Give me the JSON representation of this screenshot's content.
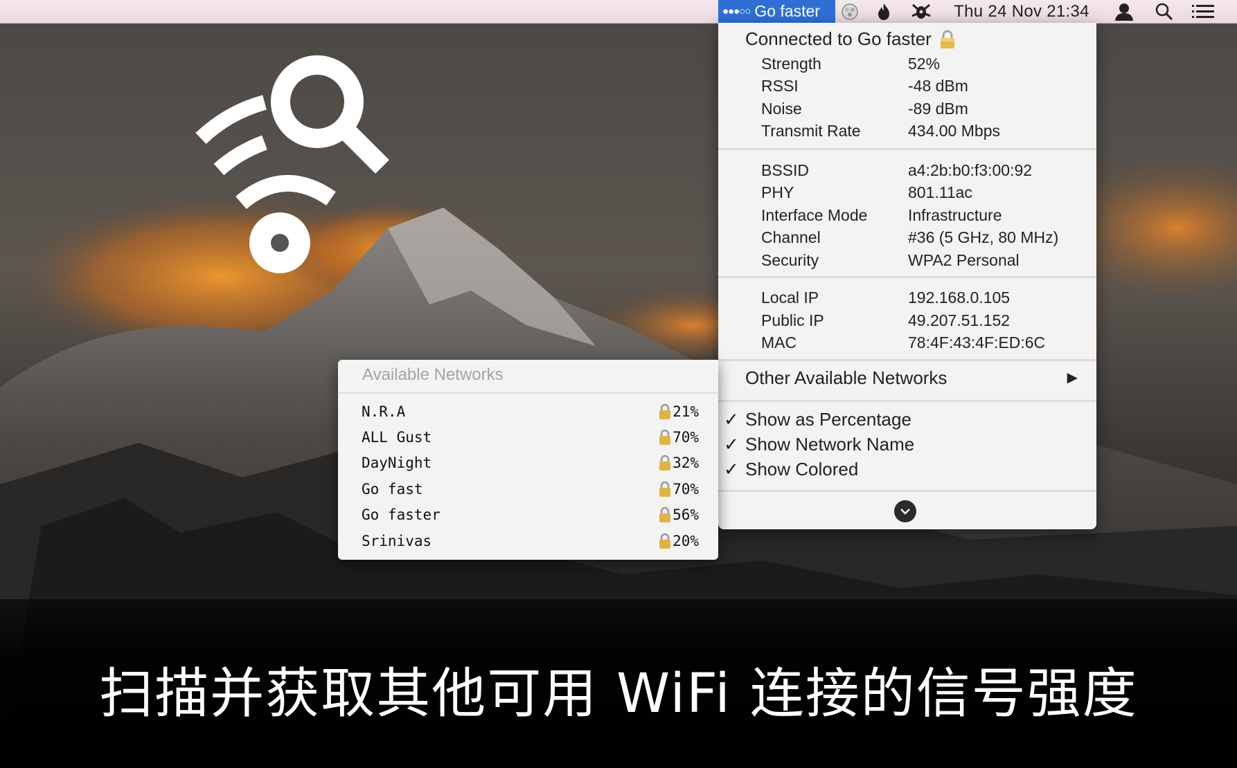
{
  "menubar": {
    "wifi_name": "Go faster",
    "clock": "Thu 24 Nov  21:34",
    "icons": [
      "wifi-signal-dots-icon",
      "colorful-ball-icon",
      "flame-icon",
      "bug-icon",
      "user-icon",
      "search-icon",
      "list-icon"
    ]
  },
  "main_menu": {
    "connected_label": "Connected to Go faster",
    "info_groups": [
      [
        {
          "key": "Strength",
          "value": "52%"
        },
        {
          "key": "RSSI",
          "value": "-48 dBm"
        },
        {
          "key": "Noise",
          "value": "-89 dBm"
        },
        {
          "key": "Transmit Rate",
          "value": "434.00 Mbps"
        }
      ],
      [
        {
          "key": "BSSID",
          "value": "a4:2b:b0:f3:00:92"
        },
        {
          "key": "PHY",
          "value": "801.11ac"
        },
        {
          "key": "Interface Mode",
          "value": "Infrastructure"
        },
        {
          "key": "Channel",
          "value": "#36 (5 GHz, 80 MHz)"
        },
        {
          "key": "Security",
          "value": "WPA2 Personal"
        }
      ],
      [
        {
          "key": "Local IP",
          "value": "192.168.0.105"
        },
        {
          "key": "Public IP",
          "value": "49.207.51.152"
        },
        {
          "key": "MAC",
          "value": "78:4F:43:4F:ED:6C"
        }
      ]
    ],
    "other_networks_label": "Other Available Networks",
    "options": [
      {
        "label": "Show as Percentage",
        "checked": true
      },
      {
        "label": "Show Network Name",
        "checked": true
      },
      {
        "label": "Show Colored",
        "checked": true
      }
    ]
  },
  "submenu": {
    "title": "Available Networks",
    "networks": [
      {
        "name": "N.R.A",
        "strength": "21%"
      },
      {
        "name": "ALL Gust",
        "strength": "70%"
      },
      {
        "name": "DayNight",
        "strength": "32%"
      },
      {
        "name": "Go fast",
        "strength": "70%"
      },
      {
        "name": "Go faster",
        "strength": "56%"
      },
      {
        "name": "Srinivas",
        "strength": "20%"
      }
    ]
  },
  "caption": "扫描并获取其他可用 WiFi 连接的信号强度",
  "colors": {
    "accent": "#2f6fd5",
    "menu_bg": "#f3f3f3",
    "caption_text": "#ffffff"
  }
}
